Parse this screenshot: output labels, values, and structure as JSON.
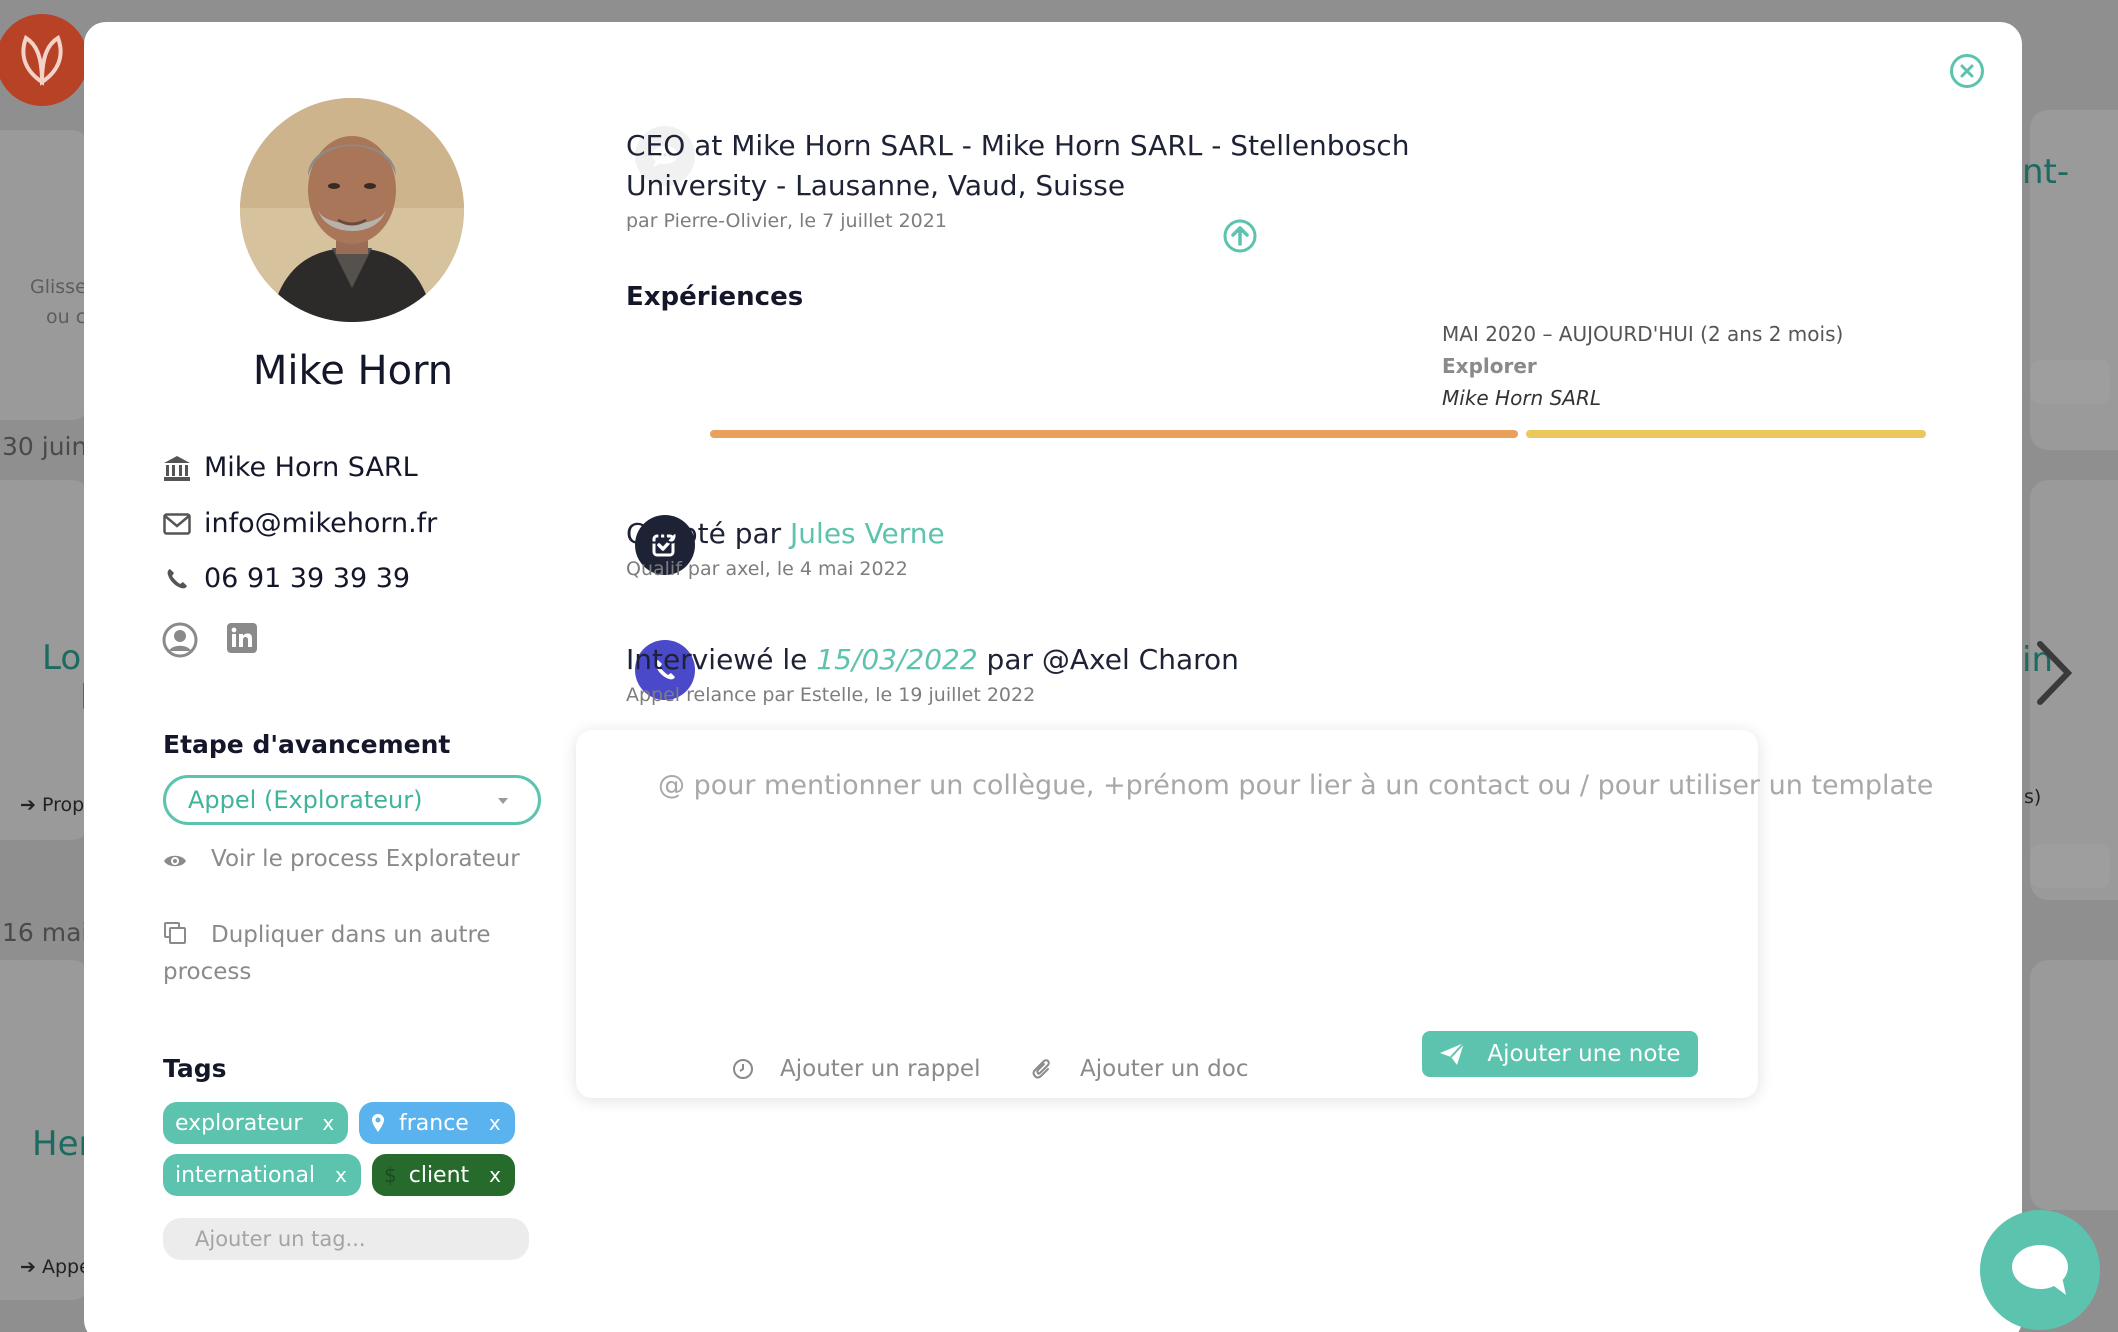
{
  "background": {
    "texts": {
      "glisse": "Glisse",
      "ou": "ou c",
      "date1": "30 juin",
      "lo": "Lo",
      "l": "l",
      "prop": "Prop",
      "date2": "16 mai",
      "her": "Her",
      "appe": "Appe",
      "nt": "nt-",
      "ing": "in",
      "s": "s)"
    }
  },
  "colors": {
    "accent": "#5cc3ae",
    "navy": "#1e2235",
    "call_purple": "#4a49c9",
    "bar_orange": "#e8a05a",
    "bar_yellow": "#ebc85b"
  },
  "contact": {
    "name": "Mike Horn",
    "company": "Mike Horn SARL",
    "email": "info@mikehorn.fr",
    "phone": "06 91 39 39 39"
  },
  "stage": {
    "title": "Etape d'avancement",
    "selected": "Appel (Explorateur)",
    "view_process": "Voir le process Explorateur",
    "duplicate": "Dupliquer dans un autre process"
  },
  "tags": {
    "title": "Tags",
    "items": [
      {
        "label": "explorateur",
        "remove": "x"
      },
      {
        "label": "france",
        "remove": "x"
      },
      {
        "label": "international",
        "remove": "x"
      },
      {
        "label": "client",
        "remove": "x"
      }
    ],
    "add_placeholder": "Ajouter un tag..."
  },
  "feed": {
    "headline": "CEO at Mike Horn SARL - Mike Horn SARL - Stellenbosch University - Lausanne, Vaud, Suisse",
    "headline_meta": "par Pierre-Olivier, le 7 juillet 2021",
    "experiences_title": "Expériences",
    "experience": {
      "dates": "MAI 2020 – AUJOURD'HUI (2 ans 2 mois)",
      "role": "Explorer",
      "company": "Mike Horn SARL"
    },
    "cooptation": {
      "prefix": "Coopté par",
      "person": "Jules Verne",
      "meta": "Qualif par axel, le 4 mai 2022"
    },
    "interview": {
      "prefix": "Interviewé le",
      "date": "15/03/2022",
      "suffix": "par @Axel Charon",
      "meta": "Appel relance par Estelle, le 19 juillet 2022"
    }
  },
  "note": {
    "placeholder": "@ pour mentionner un collègue, +prénom pour lier à un contact ou / pour utiliser un template",
    "add_reminder": "Ajouter un rappel",
    "add_doc": "Ajouter un doc",
    "submit": "Ajouter une note"
  }
}
